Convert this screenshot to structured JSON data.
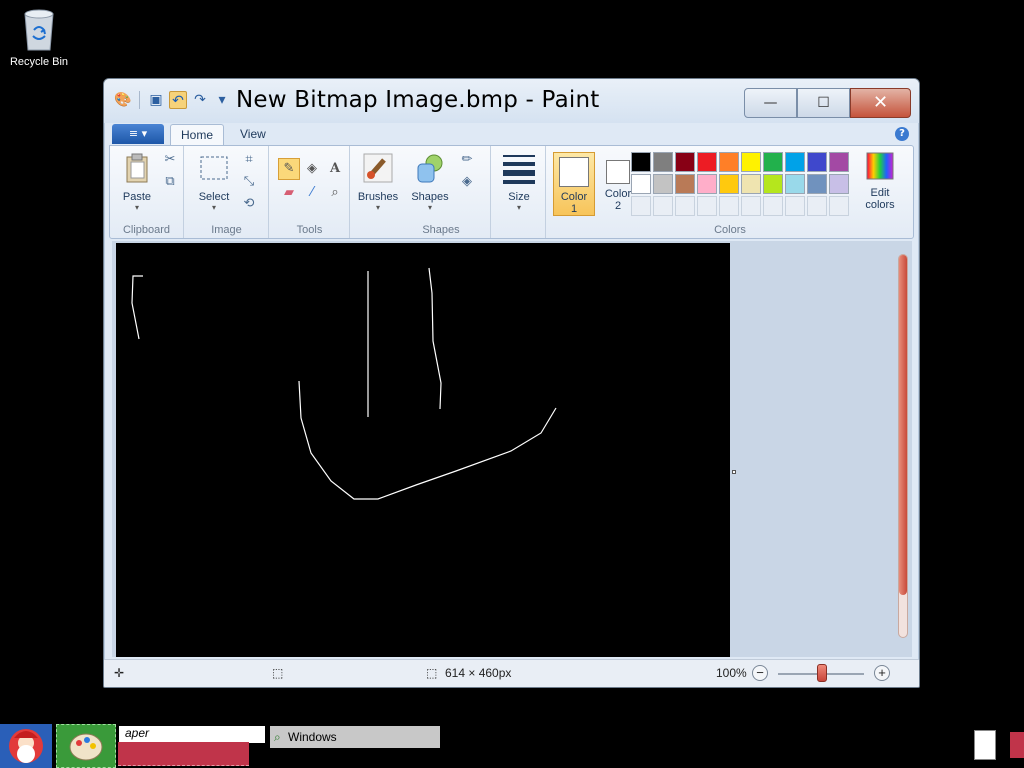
{
  "desktop": {
    "recycle_bin_label": "Recycle Bin"
  },
  "window": {
    "title": "New Bitmap Image.bmp - Paint",
    "min_label": "—",
    "max_label": "☐",
    "close_label": "✕"
  },
  "tabs": {
    "file_label": "≡ ▾",
    "home_label": "Home",
    "view_label": "View",
    "help_label": "?"
  },
  "ribbon": {
    "clipboard": {
      "group_label": "Clipboard",
      "paste_label": "Paste"
    },
    "image": {
      "group_label": "Image",
      "select_label": "Select"
    },
    "tools": {
      "group_label": "Tools"
    },
    "shapes": {
      "group_label": "Shapes",
      "brushes_label": "Brushes",
      "shapes_label": "Shapes"
    },
    "size": {
      "size_label": "Size"
    },
    "colors": {
      "group_label": "Colors",
      "color1_label": "Color",
      "color1_num": "1",
      "color2_label": "Color",
      "color2_num": "2",
      "edit_label": "Edit",
      "edit_label2": "colors",
      "palette_row1": [
        "#000000",
        "#7f7f7f",
        "#880015",
        "#ed1c24",
        "#ff7f27",
        "#fff200",
        "#22b14c",
        "#00a2e8",
        "#3f48cc",
        "#a349a4"
      ],
      "palette_row2": [
        "#ffffff",
        "#c3c3c3",
        "#b97a57",
        "#ffaec9",
        "#ffc90e",
        "#efe4b0",
        "#b5e61d",
        "#99d9ea",
        "#7092be",
        "#c8bfe7"
      ]
    }
  },
  "status": {
    "dimensions": "614 × 460px",
    "zoom": "100%",
    "zoom_minus": "−",
    "zoom_plus": "+"
  },
  "taskbar": {
    "input_text": "aper",
    "search_text": "Windows"
  }
}
